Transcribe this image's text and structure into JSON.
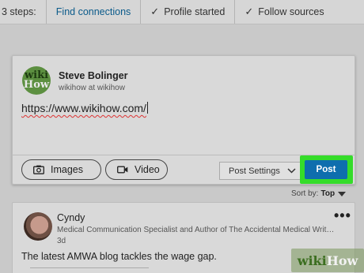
{
  "steps": {
    "lead": "3 steps:",
    "items": [
      {
        "label": "Find connections",
        "done": false
      },
      {
        "label": "Profile started",
        "done": true
      },
      {
        "label": "Follow sources",
        "done": true
      }
    ]
  },
  "composer": {
    "author": {
      "name": "Steve Bolinger",
      "subtitle": "wikihow at wikihow",
      "logo_part1": "wiki",
      "logo_part2": "How"
    },
    "text": "https://www.wikihow.com/",
    "buttons": {
      "images": "Images",
      "video": "Video",
      "settings": "Post Settings",
      "post": "Post"
    }
  },
  "sort": {
    "label": "Sort by:",
    "value": "Top"
  },
  "feed": {
    "name": "Cyndy",
    "headline": "Medical Communication Specialist and Author of The Accidental Medical Writer h...",
    "time": "3d",
    "more": "•••",
    "text": "The latest AMWA blog tackles the wage gap."
  },
  "watermark": {
    "part1": "wiki",
    "part2": "How"
  },
  "colors": {
    "accent": "#0e6eae",
    "highlight": "#35dc2a",
    "link": "#0a5a8a"
  }
}
